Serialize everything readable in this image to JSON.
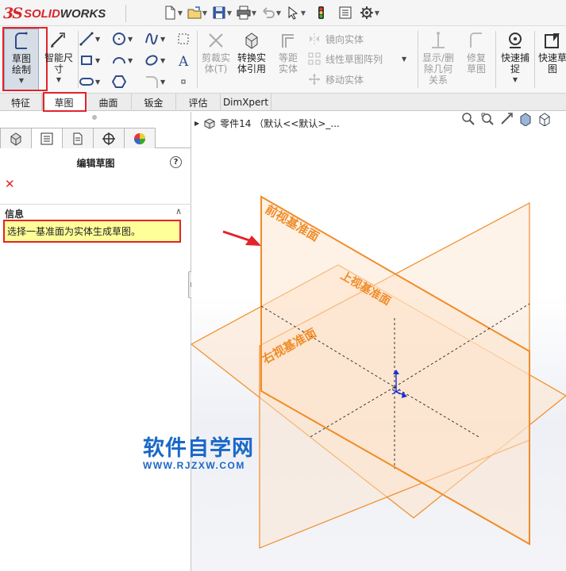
{
  "titlebar": {
    "logo_mark": "3S",
    "logo_solid": "SOLID",
    "logo_works": "WORKS"
  },
  "toolbar": {
    "sketch_label": "草图绘制",
    "smart_dim_label": "智能尺寸",
    "trim_label": "剪裁实体(T)",
    "convert_label": "转换实体引用",
    "offset_label": "等距实体",
    "mirror_label": "镜向实体",
    "linear_pattern_label": "线性草图阵列",
    "move_label": "移动实体",
    "show_delete_label": "显示/删除几何关系",
    "repair_label": "修复草图",
    "quick_snap_label": "快速捕捉",
    "quick_sketch_label": "快速草图"
  },
  "tabs": [
    {
      "label": "特征"
    },
    {
      "label": "草图"
    },
    {
      "label": "曲面"
    },
    {
      "label": "钣金"
    },
    {
      "label": "评估"
    },
    {
      "label": "DimXpert"
    }
  ],
  "property_manager": {
    "title": "编辑草图",
    "help": "?",
    "close": "✕",
    "section_title": "信息",
    "collapse": "∧",
    "message": "选择一基准面为实体生成草图。"
  },
  "tree": {
    "part_name": "零件14 （默认<<默认>_..."
  },
  "planes": {
    "front": "前视基准面",
    "top": "上视基准面",
    "right": "右视基准面"
  },
  "colors": {
    "plane_edge": "#f08c28",
    "highlight_red": "#e2232a",
    "info_bg": "#ffff9a",
    "watermark_blue": "#1a68c7"
  },
  "watermark": {
    "cn": "软件自学网",
    "url": "WWW.RJZXW.COM"
  }
}
